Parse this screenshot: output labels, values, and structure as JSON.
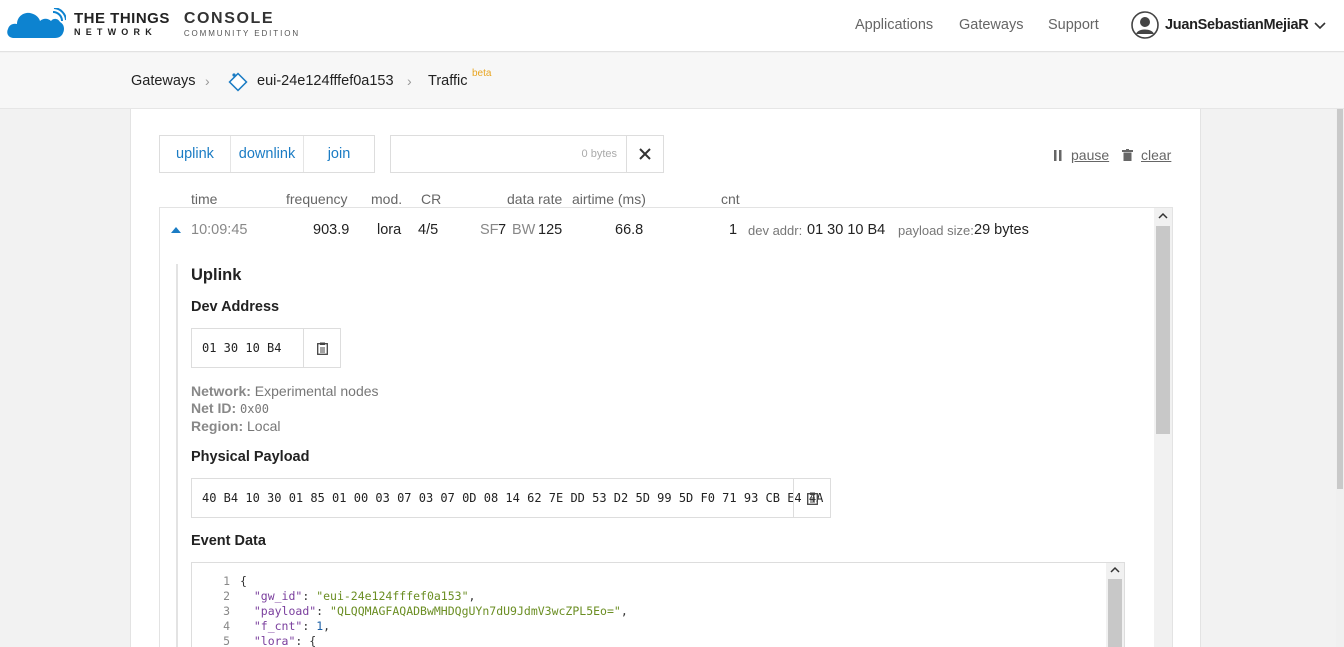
{
  "header": {
    "brand_line1": "THE THINGS",
    "brand_line2": "NETWORK",
    "console_line1": "CONSOLE",
    "console_line2": "COMMUNITY EDITION",
    "nav": [
      "Applications",
      "Gateways",
      "Support"
    ],
    "user_name": "JuanSebastianMejiaR",
    "brand_color": "#0d83d0"
  },
  "breadcrumb": {
    "root": "Gateways",
    "gateway": "eui-24e124fffef0a153",
    "page": "Traffic",
    "badge": "beta"
  },
  "toolbar": {
    "filters": [
      "uplink",
      "downlink",
      "join"
    ],
    "search_value": "",
    "bytes": "0 bytes",
    "pause": "pause",
    "clear": "clear"
  },
  "columns": [
    "time",
    "frequency",
    "mod.",
    "CR",
    "data rate",
    "airtime (ms)",
    "cnt"
  ],
  "row": {
    "time": "10:09:45",
    "frequency": "903.9",
    "mod": "lora",
    "cr": "4/5",
    "sf_label": "SF",
    "sf": "7",
    "bw_label": "BW",
    "bw": "125",
    "airtime": "66.8",
    "cnt": "1",
    "dev_addr_label": "dev addr:",
    "dev_addr": "01 30 10 B4",
    "payload_size_label": "payload size:",
    "payload_size": "29 bytes"
  },
  "detail": {
    "title": "Uplink",
    "dev_address_heading": "Dev Address",
    "dev_address": "01 30 10 B4",
    "network_label": "Network:",
    "network": "Experimental nodes",
    "netid_label": "Net ID:",
    "netid": "0x00",
    "region_label": "Region:",
    "region": "Local",
    "payload_heading": "Physical Payload",
    "payload": "40 B4 10 30 01 85 01 00 03 07 03 07 0D 08 14 62 7E DD 53 D2 5D 99 5D F0 71 93 CB E4 4A",
    "event_heading": "Event Data"
  },
  "event_code": {
    "line_numbers": [
      "1",
      "2",
      "3",
      "4",
      "5"
    ],
    "l1": "{",
    "l2_key": "\"gw_id\"",
    "l2_val": "\"eui-24e124fffef0a153\"",
    "l3_key": "\"payload\"",
    "l3_val": "\"QLQQMAGFAQADBwMHDQgUYn7dU9JdmV3wcZPL5Eo=\"",
    "l4_key": "\"f_cnt\"",
    "l4_val": "1",
    "l5_key": "\"lora\"",
    "l5_val": "{"
  }
}
